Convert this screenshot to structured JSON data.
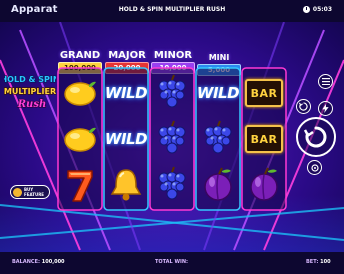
{
  "topbar": {
    "brand": "Apparat",
    "title": "HOLD & SPIN MULTIPLIER RUSH",
    "clock": "05:03"
  },
  "jackpots": [
    {
      "label": "GRAND",
      "value": "100,000",
      "color": "#ffd23f"
    },
    {
      "label": "MAJOR",
      "value": "20,000",
      "color": "#ff4d4d"
    },
    {
      "label": "MINOR",
      "value": "10,000",
      "color": "#b860ff"
    },
    {
      "label": "MINI",
      "value": "5,000",
      "color": "#3aa2ff"
    }
  ],
  "logo": {
    "line1": "HOLD & SPIN",
    "line2": "MULTIPLIER",
    "line3": "Rush"
  },
  "reels": [
    [
      "lemon",
      "lemon",
      "seven"
    ],
    [
      "wild",
      "wild",
      "bell"
    ],
    [
      "grapes",
      "grapes",
      "grapes"
    ],
    [
      "wild",
      "grapes",
      "plum"
    ],
    [
      "bar",
      "bar",
      "plum"
    ]
  ],
  "symbols": {
    "wild": "WILD",
    "bar": "BAR"
  },
  "buttons": {
    "buy_line1": "BUY",
    "buy_line2": "FEATURE",
    "menu_icon": "hamburger-icon",
    "autoplay_icon": "autoplay-icon",
    "turbo_icon": "lightning-icon",
    "spin_icon": "spin-arrow-icon",
    "bet_icon": "coin-stack-icon"
  },
  "bottombar": {
    "balance_label": "BALANCE:",
    "balance_value": "100,000",
    "total_win_label": "TOTAL WIN:",
    "total_win_value": "",
    "bet_label": "BET:",
    "bet_value": "100"
  },
  "colors": {
    "reel_glow_pink": "#ff39d4",
    "reel_glow_blue": "#34c8ff",
    "background": "#12004a"
  }
}
